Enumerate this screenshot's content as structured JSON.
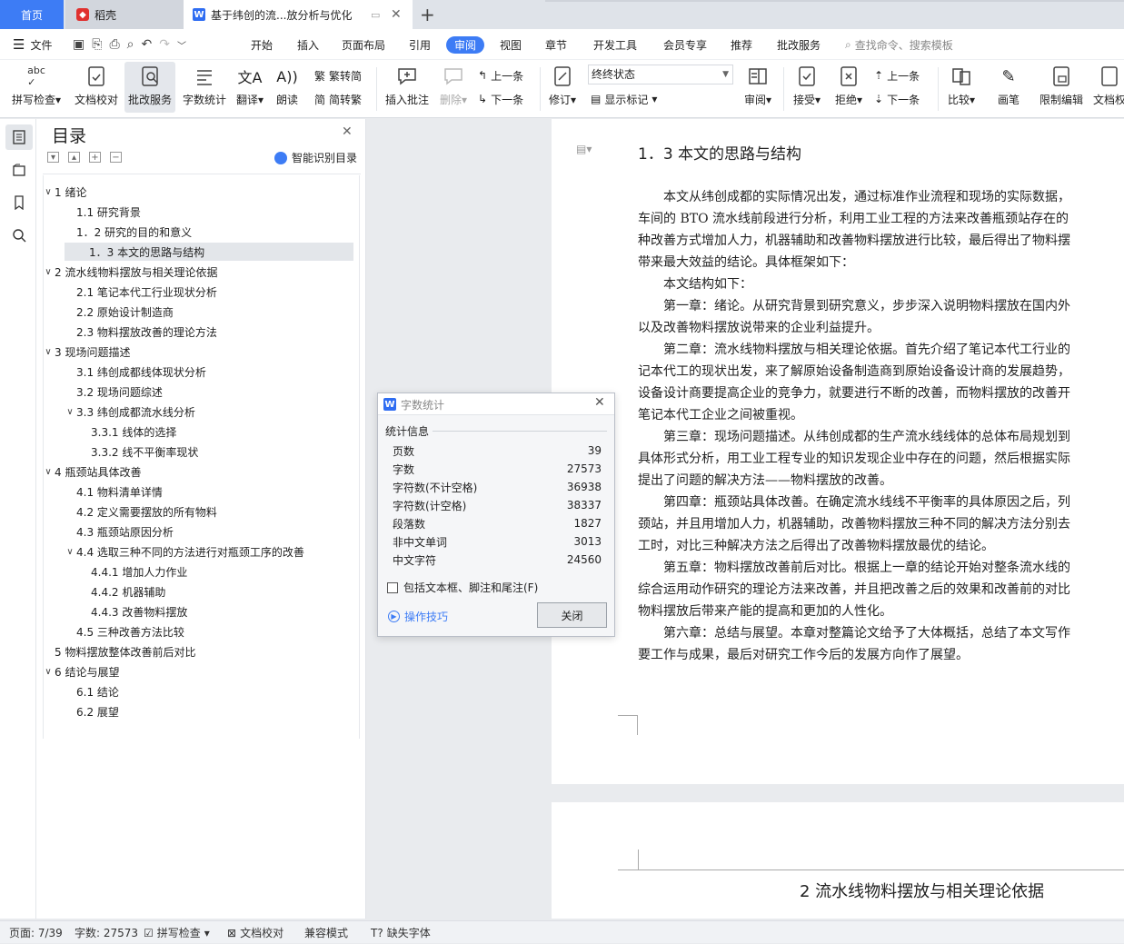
{
  "tabs": {
    "home": "首页",
    "daoke": "稻壳",
    "doc": "基于纬创的流...放分析与优化"
  },
  "menu": {
    "file": "文件",
    "items": [
      "开始",
      "插入",
      "页面布局",
      "引用",
      "审阅",
      "视图",
      "章节",
      "开发工具",
      "会员专享",
      "推荐",
      "批改服务"
    ],
    "search": "查找命令、搜索模板"
  },
  "ribbon": {
    "spell": "拼写检查",
    "proof": "文档校对",
    "review_service": "批改服务",
    "wordcount": "字数统计",
    "translate": "翻译",
    "read": "朗读",
    "to_simplified": "繁转简",
    "to_traditional": "简转繁",
    "insert_comment": "插入批注",
    "delete": "删除",
    "prev": "上一条",
    "next": "下一条",
    "revise": "修订",
    "status_value": "终终状态",
    "show_marks": "显示标记",
    "review": "审阅",
    "accept": "接受",
    "reject": "拒绝",
    "prev2": "上一条",
    "next2": "下一条",
    "compare": "比较",
    "pen": "画笔",
    "restrict": "限制编辑",
    "docperm": "文档权"
  },
  "toc": {
    "title": "目录",
    "smart": "智能识别目录",
    "items": [
      {
        "label": "1 绪论",
        "level": 0,
        "caret": "∨"
      },
      {
        "label": "1.1 研究背景",
        "level": 1
      },
      {
        "label": "1．2 研究的目的和意义",
        "level": 1
      },
      {
        "label": "1．3 本文的思路与结构",
        "level": 1,
        "selected": true
      },
      {
        "label": "2 流水线物料摆放与相关理论依据",
        "level": 0,
        "caret": "∨"
      },
      {
        "label": "2.1 笔记本代工行业现状分析",
        "level": 1
      },
      {
        "label": "2.2 原始设计制造商",
        "level": 1
      },
      {
        "label": "2.3 物料摆放改善的理论方法",
        "level": 1
      },
      {
        "label": "3 现场问题描述",
        "level": 0,
        "caret": "∨"
      },
      {
        "label": "3.1 纬创成都线体现状分析",
        "level": 1
      },
      {
        "label": "3.2 现场问题综述",
        "level": 1
      },
      {
        "label": "3.3 纬创成都流水线分析",
        "level": 1,
        "caret": "∨"
      },
      {
        "label": "3.3.1 线体的选择",
        "level": 2
      },
      {
        "label": "3.3.2 线不平衡率现状",
        "level": 2
      },
      {
        "label": "4 瓶颈站具体改善",
        "level": 0,
        "caret": "∨"
      },
      {
        "label": "4.1 物料清单详情",
        "level": 1
      },
      {
        "label": "4.2 定义需要摆放的所有物料",
        "level": 1
      },
      {
        "label": "4.3 瓶颈站原因分析",
        "level": 1
      },
      {
        "label": "4.4 选取三种不同的方法进行对瓶颈工序的改善",
        "level": 1,
        "caret": "∨"
      },
      {
        "label": "4.4.1 增加人力作业",
        "level": 2
      },
      {
        "label": "4.4.2 机器辅助",
        "level": 2
      },
      {
        "label": "4.4.3 改善物料摆放",
        "level": 2
      },
      {
        "label": "4.5 三种改善方法比较",
        "level": 1
      },
      {
        "label": "5 物料摆放整体改善前后对比",
        "level": 0
      },
      {
        "label": "6 结论与展望",
        "level": 0,
        "caret": "∨"
      },
      {
        "label": "6.1 结论",
        "level": 1
      },
      {
        "label": "6.2 展望",
        "level": 1
      }
    ]
  },
  "doc": {
    "heading": "1．3 本文的思路与结构",
    "lines": [
      "　　本文从纬创成都的实际情况出发，通过标准作业流程和现场的实际数据，",
      "车间的 BTO 流水线前段进行分析，利用工业工程的方法来改善瓶颈站存在的",
      "种改善方式增加人力，机器辅助和改善物料摆放进行比较，最后得出了物料摆",
      "带来最大效益的结论。具体框架如下：",
      "　　本文结构如下：",
      "　　第一章：绪论。从研究背景到研究意义，步步深入说明物料摆放在国内外",
      "以及改善物料摆放说带来的企业利益提升。",
      "　　第二章：流水线物料摆放与相关理论依据。首先介绍了笔记本代工行业的",
      "记本代工的现状出发，来了解原始设备制造商到原始设备设计商的发展趋势，",
      "设备设计商要提高企业的竞争力，就要进行不断的改善，而物料摆放的改善开",
      "笔记本代工企业之间被重视。",
      "　　第三章：现场问题描述。从纬创成都的生产流水线线体的总体布局规划到",
      "具体形式分析，用工业工程专业的知识发现企业中存在的问题，然后根据实际",
      "提出了问题的解决方法——物料摆放的改善。",
      "　　第四章：瓶颈站具体改善。在确定流水线线不平衡率的具体原因之后，列",
      "颈站，并且用增加人力，机器辅助，改善物料摆放三种不同的解决方法分别去",
      "工时，对比三种解决方法之后得出了改善物料摆放最优的结论。",
      "　　第五章：物料摆放改善前后对比。根据上一章的结论开始对整条流水线的",
      "综合运用动作研究的理论方法来改善，并且把改善之后的效果和改善前的对比",
      "物料摆放后带来产能的提高和更加的人性化。",
      "　　第六章：总结与展望。本章对整篇论文给予了大体概括，总结了本文写作",
      "要工作与成果，最后对研究工作今后的发展方向作了展望。"
    ],
    "heading2": "2  流水线物料摆放与相关理论依据"
  },
  "dialog": {
    "title": "字数统计",
    "group": "统计信息",
    "rows": [
      {
        "label": "页数",
        "value": "39"
      },
      {
        "label": "字数",
        "value": "27573"
      },
      {
        "label": "字符数(不计空格)",
        "value": "36938"
      },
      {
        "label": "字符数(计空格)",
        "value": "38337"
      },
      {
        "label": "段落数",
        "value": "1827"
      },
      {
        "label": "非中文单词",
        "value": "3013"
      },
      {
        "label": "中文字符",
        "value": "24560"
      }
    ],
    "checkbox": "包括文本框、脚注和尾注(F)",
    "tips": "操作技巧",
    "close": "关闭"
  },
  "status": {
    "page": "页面: 7/39",
    "words": "字数: 27573",
    "spell": "拼写检查",
    "proof": "文档校对",
    "compat": "兼容模式",
    "font": "缺失字体"
  },
  "colors": {
    "accent": "#3d7cf5",
    "wps_red": "#e0312f"
  }
}
